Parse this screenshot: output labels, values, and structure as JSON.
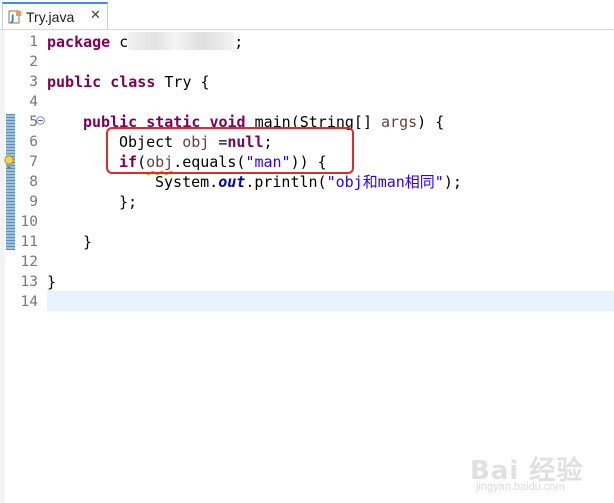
{
  "tab": {
    "title": "Try.java",
    "close_glyph": "✕",
    "icon": "java-file-icon"
  },
  "line_numbers": [
    "1",
    "2",
    "3",
    "4",
    "5",
    "6",
    "7",
    "8",
    "9",
    "10",
    "11",
    "12",
    "13",
    "14"
  ],
  "code": {
    "l1": {
      "kw": "package",
      "rest_before_blur": " c",
      "rest_after_blur": ";"
    },
    "l3": {
      "kw1": "public",
      "kw2": "class",
      "name": " Try {"
    },
    "l5": {
      "kw1": "public",
      "kw2": "static",
      "kw3": "void",
      "rest_a": " main(String[] ",
      "param": "args",
      "rest_b": ") {"
    },
    "l6": {
      "type": "Object ",
      "var": "obj",
      "op": " =",
      "kw": "null",
      "end": ";"
    },
    "l7": {
      "kw": "if",
      "open": "(",
      "var": "obj",
      "mid": ".equals(",
      "str": "\"man\"",
      "end": ")) {"
    },
    "l8": {
      "a": "System.",
      "fld": "out",
      "b": ".println(",
      "str": "\"obj和man相同\"",
      "end": ");"
    },
    "l9": {
      "text": "};"
    },
    "l11": {
      "text": "}"
    },
    "l13": {
      "text": "}"
    }
  },
  "watermark": {
    "main": "Bai 经验",
    "sub": "jingyan.baidu.com"
  },
  "colors": {
    "keyword": "#7f0055",
    "string": "#2a00ff",
    "field": "#0000c0",
    "highlight_box": "#e02a2a",
    "current_line": "#e8f2fe"
  }
}
